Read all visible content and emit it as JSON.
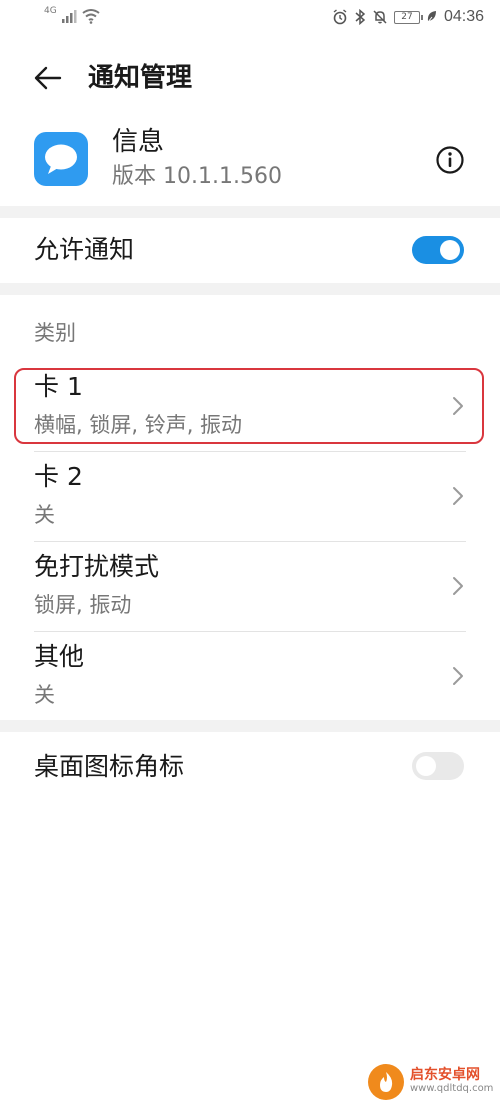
{
  "status_bar": {
    "network": "4G",
    "battery": "27",
    "time": "04:36"
  },
  "header": {
    "title": "通知管理"
  },
  "app": {
    "name": "信息",
    "version": "版本 10.1.1.560"
  },
  "allow_notifications": {
    "label": "允许通知",
    "enabled": true
  },
  "category": {
    "section_label": "类别",
    "items": [
      {
        "title": "卡 1",
        "subtitle": "横幅, 锁屏, 铃声, 振动"
      },
      {
        "title": "卡 2",
        "subtitle": "关"
      },
      {
        "title": "免打扰模式",
        "subtitle": "锁屏, 振动"
      },
      {
        "title": "其他",
        "subtitle": "关"
      }
    ]
  },
  "badge_setting": {
    "label": "桌面图标角标",
    "enabled": false
  },
  "watermark": {
    "name": "启东安卓网",
    "url": "www.qdltdq.com"
  },
  "colors": {
    "accent": "#1a8fe3",
    "highlight": "#d9363e",
    "app_icon": "#2f9bf0"
  }
}
